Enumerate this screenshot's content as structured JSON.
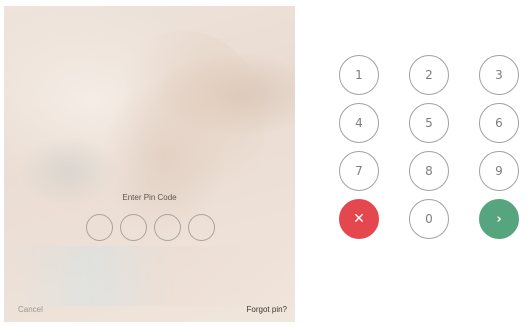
{
  "lock_screen": {
    "title": "Enter Pin Code",
    "cancel_label": "Cancel",
    "forgot_label": "Forgot pin?",
    "pin_length": 4
  },
  "keypad": {
    "keys": [
      "1",
      "2",
      "3",
      "4",
      "5",
      "6",
      "7",
      "8",
      "9",
      "✕",
      "0",
      "›"
    ],
    "cancel_color": "#e5474e",
    "submit_color": "#56a57e"
  }
}
